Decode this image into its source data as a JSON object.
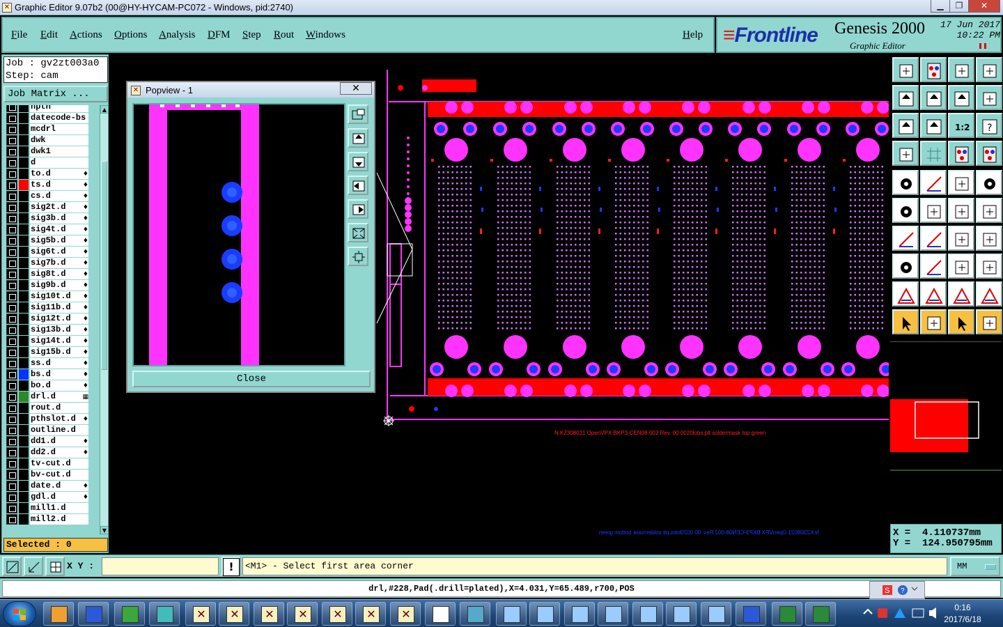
{
  "window": {
    "title": "Graphic Editor 9.07b2 (00@HY-HYCAM-PC072 - Windows, pid:2740)"
  },
  "menu": {
    "file": "File",
    "edit": "Edit",
    "actions": "Actions",
    "options": "Options",
    "analysis": "Analysis",
    "dfm": "DFM",
    "step": "Step",
    "rout": "Rout",
    "windows": "Windows",
    "help": "Help"
  },
  "brand": {
    "logo_prefix": "F",
    "logo_rest": "rontline",
    "product": "Genesis 2000",
    "subtitle": "Graphic Editor",
    "date": "17 Jun 2017",
    "time": "10:22 PM"
  },
  "job": {
    "job_line": "Job : gv2zt003a0",
    "step_line": "Step: cam",
    "matrix_button": "Job Matrix ..."
  },
  "layers": [
    {
      "name": "npth",
      "color": "#000000",
      "mark": ""
    },
    {
      "name": "datecode-bs",
      "color": "#000000",
      "mark": ""
    },
    {
      "name": "mcdrl",
      "color": "#000000",
      "mark": ""
    },
    {
      "name": "dwk",
      "color": "#000000",
      "mark": ""
    },
    {
      "name": "dwk1",
      "color": "#000000",
      "mark": ""
    },
    {
      "name": "d",
      "color": "#000000",
      "mark": ""
    },
    {
      "name": "to.d",
      "color": "#000000",
      "mark": "♦"
    },
    {
      "name": "ts.d",
      "color": "#ff0000",
      "mark": "♦"
    },
    {
      "name": "cs.d",
      "color": "#000000",
      "mark": "♦"
    },
    {
      "name": "sig2t.d",
      "color": "#000000",
      "mark": "♦"
    },
    {
      "name": "sig3b.d",
      "color": "#000000",
      "mark": "♦"
    },
    {
      "name": "sig4t.d",
      "color": "#000000",
      "mark": "♦"
    },
    {
      "name": "sig5b.d",
      "color": "#000000",
      "mark": "♦"
    },
    {
      "name": "sig6t.d",
      "color": "#000000",
      "mark": "♦"
    },
    {
      "name": "sig7b.d",
      "color": "#000000",
      "mark": "♦"
    },
    {
      "name": "sig8t.d",
      "color": "#000000",
      "mark": "♦"
    },
    {
      "name": "sig9b.d",
      "color": "#000000",
      "mark": "♦"
    },
    {
      "name": "sig10t.d",
      "color": "#000000",
      "mark": "♦"
    },
    {
      "name": "sig11b.d",
      "color": "#000000",
      "mark": "♦"
    },
    {
      "name": "sig12t.d",
      "color": "#000000",
      "mark": "♦"
    },
    {
      "name": "sig13b.d",
      "color": "#000000",
      "mark": "♦"
    },
    {
      "name": "sig14t.d",
      "color": "#000000",
      "mark": "♦"
    },
    {
      "name": "sig15b.d",
      "color": "#000000",
      "mark": "♦"
    },
    {
      "name": "ss.d",
      "color": "#000000",
      "mark": "♦"
    },
    {
      "name": "bs.d",
      "color": "#0033ff",
      "mark": "♦"
    },
    {
      "name": "bo.d",
      "color": "#000000",
      "mark": "♦"
    },
    {
      "name": "drl.d",
      "color": "#2a8a2a",
      "mark": "▦"
    },
    {
      "name": "rout.d",
      "color": "#000000",
      "mark": ""
    },
    {
      "name": "pthslot.d",
      "color": "#000000",
      "mark": "♦"
    },
    {
      "name": "outline.d",
      "color": "#000000",
      "mark": ""
    },
    {
      "name": "dd1.d",
      "color": "#000000",
      "mark": "♦"
    },
    {
      "name": "dd2.d",
      "color": "#000000",
      "mark": "♦"
    },
    {
      "name": "tv-cut.d",
      "color": "#000000",
      "mark": ""
    },
    {
      "name": "bv-cut.d",
      "color": "#000000",
      "mark": ""
    },
    {
      "name": "date.d",
      "color": "#000000",
      "mark": "♦"
    },
    {
      "name": "gdl.d",
      "color": "#000000",
      "mark": "♦"
    },
    {
      "name": "mill1.d",
      "color": "#000000",
      "mark": ""
    },
    {
      "name": "mill2.d",
      "color": "#000000",
      "mark": ""
    }
  ],
  "selected_text": "Selected : 0",
  "popview": {
    "title": "Popview - 1",
    "close_label": "Close",
    "close_x": "✕"
  },
  "canvas": {
    "annotation_top": "N.K2308021 OpenVPX BKP3-CEN08-002 Rev. 00  0020lobs.plt soldermask top green",
    "annotation_bottom": "N.K2308021 OpenVPX BKP3-CEN08-002 Rev. 00  0020lobs.plt soldermask bottom green"
  },
  "coords": {
    "x_line": "X =  4.110737mm",
    "y_line": "Y =  124.950795mm"
  },
  "cmd": {
    "xy_label": "X Y :",
    "xy_value": "",
    "prompt": "<M1> - Select first area corner",
    "units": "MM",
    "warn": "!"
  },
  "info": "drl,#228,Pad(.drill=plated),X=4.031,Y=65.489,r700,POS",
  "clock": {
    "time": "0:16",
    "date": "2017/6/18"
  },
  "colors": {
    "panel": "#92d6d0",
    "magenta": "#ff33ff",
    "red": "#ff0000",
    "blue": "#1a3cff",
    "field": "#fffbd0"
  }
}
